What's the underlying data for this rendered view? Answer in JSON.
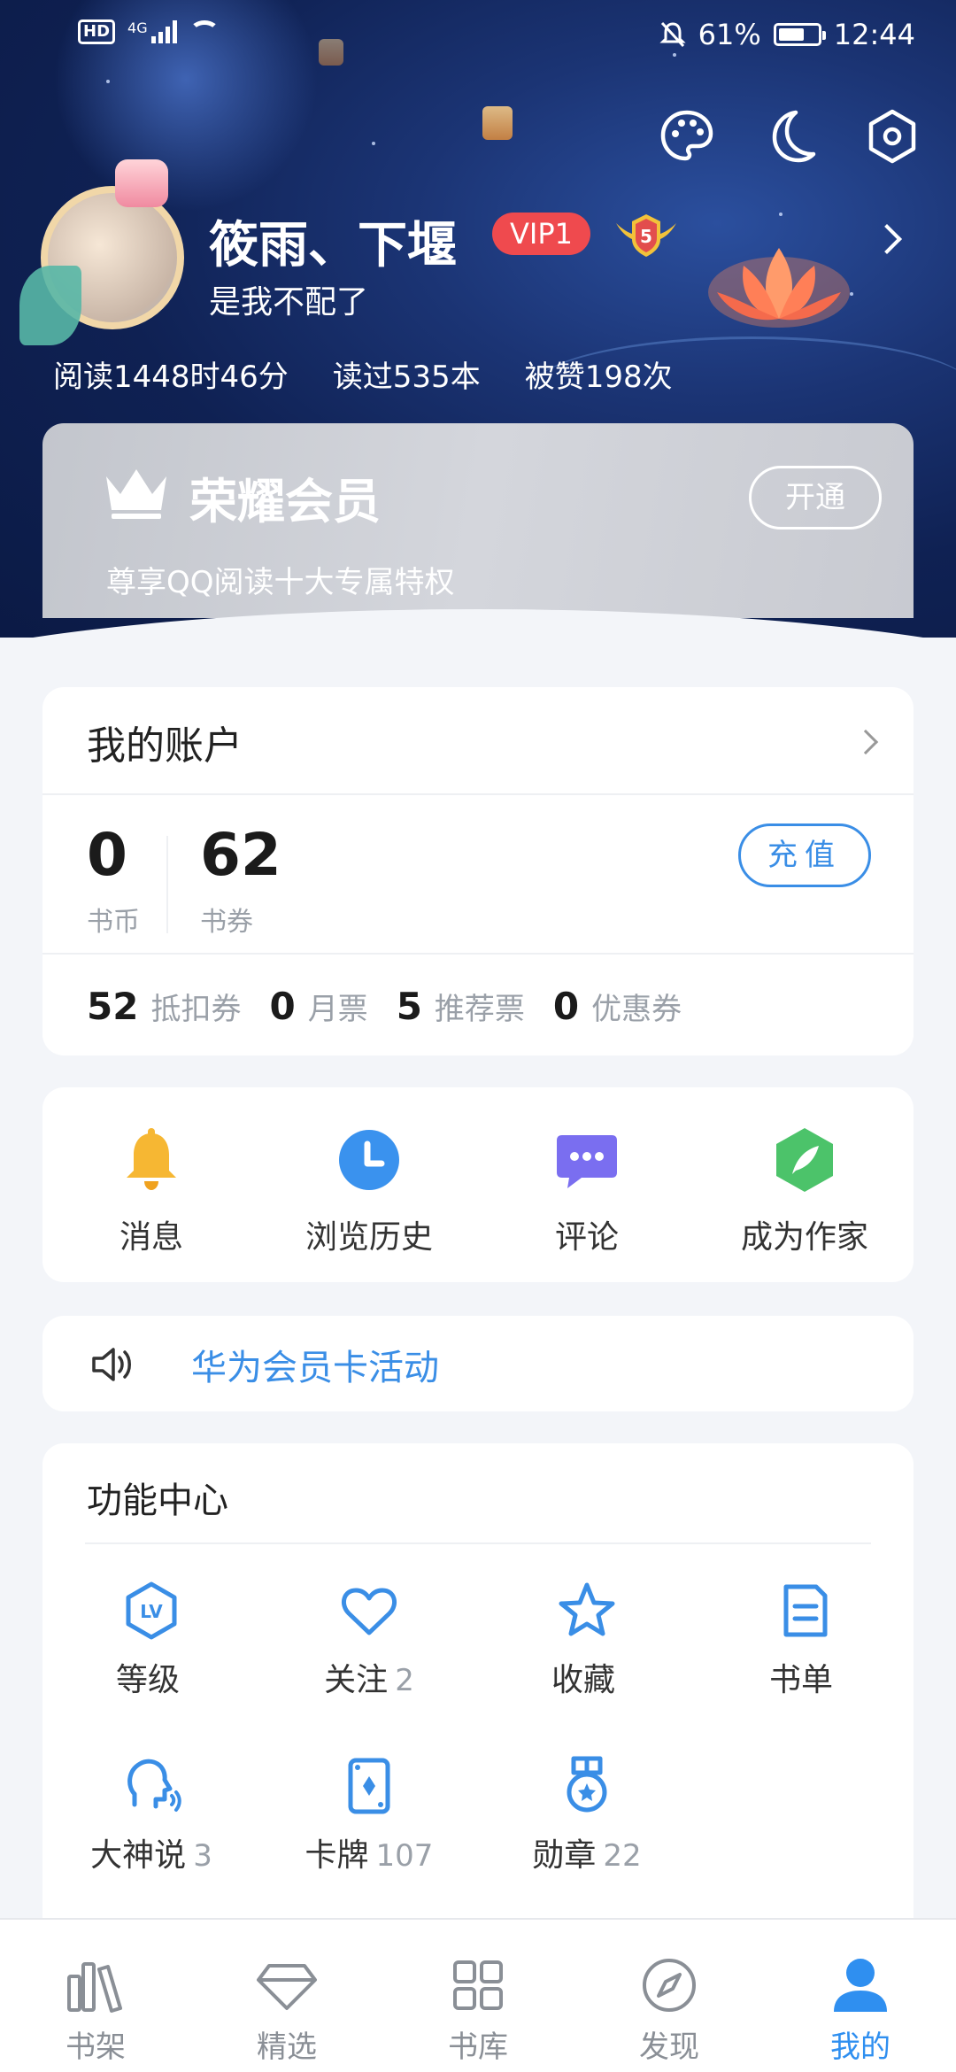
{
  "status_bar": {
    "battery": "61%",
    "time": "12:44",
    "hd": "HD",
    "network": "4G"
  },
  "profile": {
    "name": "筱雨、下堰",
    "vip": "VIP1",
    "level": "5",
    "signature": "是我不配了",
    "stats": [
      "阅读1448时46分",
      "读过535本",
      "被赞198次"
    ]
  },
  "membership": {
    "title": "荣耀会员",
    "desc": "尊享QQ阅读十大专属特权",
    "open_label": "开通"
  },
  "account": {
    "title": "我的账户",
    "coins": {
      "value": "0",
      "label": "书币"
    },
    "vouchers": {
      "value": "62",
      "label": "书券"
    },
    "recharge_label": "充值",
    "tickets": [
      {
        "value": "52",
        "label": "抵扣券"
      },
      {
        "value": "0",
        "label": "月票"
      },
      {
        "value": "5",
        "label": "推荐票"
      },
      {
        "value": "0",
        "label": "优惠券"
      }
    ]
  },
  "quick": [
    {
      "label": "消息",
      "icon": "bell-icon",
      "color": "#f6b733"
    },
    {
      "label": "浏览历史",
      "icon": "clock-icon",
      "color": "#3a92ee"
    },
    {
      "label": "评论",
      "icon": "comment-icon",
      "color": "#7a6ef0"
    },
    {
      "label": "成为作家",
      "icon": "feather-icon",
      "color": "#4cc36a"
    }
  ],
  "notice": {
    "text": "华为会员卡活动"
  },
  "func_center": {
    "title": "功能中心",
    "items": [
      {
        "label": "等级",
        "count": "",
        "icon": "level-icon"
      },
      {
        "label": "关注",
        "count": "2",
        "icon": "heart-icon"
      },
      {
        "label": "收藏",
        "count": "",
        "icon": "star-icon"
      },
      {
        "label": "书单",
        "count": "",
        "icon": "booklist-icon"
      },
      {
        "label": "大神说",
        "count": "3",
        "icon": "talk-icon"
      },
      {
        "label": "卡牌",
        "count": "107",
        "icon": "card-icon"
      },
      {
        "label": "勋章",
        "count": "22",
        "icon": "medal-icon"
      }
    ]
  },
  "tabs": [
    {
      "label": "书架",
      "icon": "bookshelf-icon"
    },
    {
      "label": "精选",
      "icon": "diamond-icon"
    },
    {
      "label": "书库",
      "icon": "grid-icon"
    },
    {
      "label": "发现",
      "icon": "compass-icon"
    },
    {
      "label": "我的",
      "icon": "user-icon",
      "active": true
    }
  ],
  "colors": {
    "accent": "#3a8ee6",
    "vip": "#ef4a4e",
    "hero": "#0f2153"
  }
}
